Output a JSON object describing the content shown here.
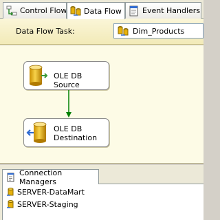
{
  "tabs": [
    {
      "label": "Control Flow",
      "icon": "control-flow-icon",
      "active": false
    },
    {
      "label": "Data Flow",
      "icon": "data-flow-icon",
      "active": true
    },
    {
      "label": "Event Handlers",
      "icon": "event-handlers-icon",
      "active": false
    }
  ],
  "task": {
    "label": "Data Flow Task:",
    "selected": "Dim_Products",
    "icon": "data-flow-task-icon"
  },
  "canvas": {
    "components": [
      {
        "label": "OLE DB Source",
        "icon": "ole-db-source-icon"
      },
      {
        "label": "OLE DB Destination",
        "label_line1": "OLE DB",
        "label_line2": "Destination",
        "icon": "ole-db-destination-icon"
      }
    ],
    "path_color": "#008000"
  },
  "connection_managers": {
    "tab_label": "Connection Managers",
    "items": [
      {
        "label": "SERVER-DataMart",
        "icon": "connection-icon"
      },
      {
        "label": "SERVER-Staging",
        "icon": "connection-icon"
      }
    ]
  },
  "colors": {
    "canvas_bg": "#fdfbe6",
    "task_bar_bg": "#f2eab8",
    "cylinder": "#e8b20c"
  }
}
